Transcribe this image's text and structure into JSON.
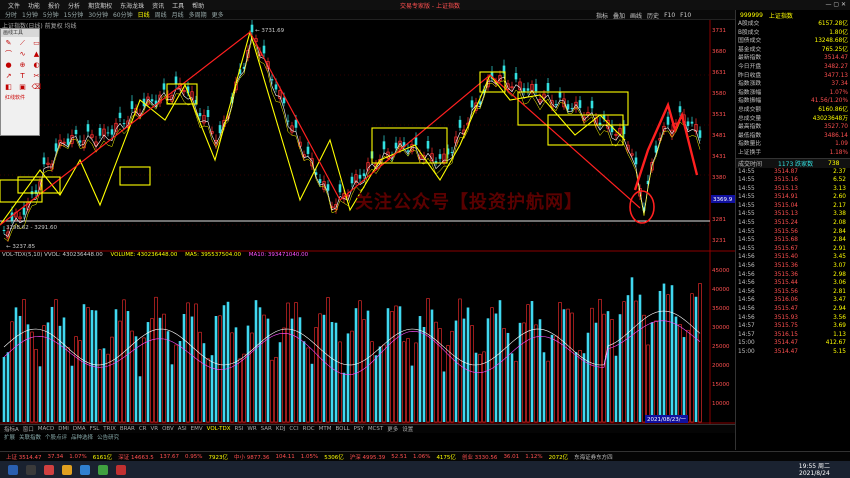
{
  "app_title": "交易专家版 - 上证指数",
  "menus": [
    "文件",
    "功能",
    "报价",
    "分析",
    "期货期权",
    "东海龙珠",
    "资讯",
    "工具",
    "帮助"
  ],
  "periods": [
    "分时",
    "1分钟",
    "5分钟",
    "15分钟",
    "30分钟",
    "60分钟",
    "日线",
    "周线",
    "月线",
    "多周期",
    "更多"
  ],
  "active_period": "日线",
  "right_tools": [
    "指标",
    "叠加",
    "画线",
    "历史",
    "F10",
    "F10"
  ],
  "chart_title": "上证指数(日线) 前复权 均线",
  "drawing_tools": {
    "title": "画线工具",
    "footer": "红线软件",
    "buttons": [
      "✎",
      "⟋",
      "▭",
      "⌒",
      "∿",
      "▲",
      "●",
      "⊕",
      "◐",
      "↗",
      "T",
      "✂",
      "◧",
      "▣",
      "⌫"
    ]
  },
  "price_annotations": {
    "high": "3731.69",
    "mid": "3298.62 - 3291.60",
    "low": "3237.85"
  },
  "y_axis": [
    "3731",
    "3680",
    "3631",
    "3580",
    "3531",
    "3481",
    "3431",
    "3380",
    "3331",
    "3281",
    "3231"
  ],
  "vol_legend": {
    "name": "VOL-TDX(5,10) VVOL: 430236448.00",
    "volume": "VOLUME: 430236448.00",
    "ma5": "MA5: 395537504.00",
    "ma10": "MA10: 393471040.00"
  },
  "vol_axis": [
    "45000",
    "40000",
    "35000",
    "30000",
    "25000",
    "20000",
    "15000",
    "10000"
  ],
  "watermark": "关注公众号【投资护航网】",
  "indicator_tabs": [
    "指标A",
    "窗口",
    "MACD",
    "DMI",
    "DMA",
    "FSL",
    "TRIX",
    "BRAR",
    "CR",
    "VR",
    "OBV",
    "ASI",
    "EMV",
    "VOL-TDX",
    "RSI",
    "WR",
    "SAR",
    "KDJ",
    "CCI",
    "ROC",
    "MTM",
    "BOLL",
    "PSY",
    "MCST",
    "更多",
    "设置"
  ],
  "indicator_tabs2": [
    "扩展",
    "关联指数",
    "个股点评",
    "品种选择",
    "公告研究"
  ],
  "date_box": "2021/08/23/一",
  "side": {
    "code": "999999",
    "name": "上证指数",
    "stats": [
      [
        "A股成交",
        "6157.28亿"
      ],
      [
        "B股成交",
        "1.80亿"
      ],
      [
        "国债成交",
        "13248.68亿"
      ],
      [
        "基金成交",
        "765.25亿"
      ],
      [
        "最新指数",
        "3514.47"
      ],
      [
        "今日开盘",
        "3482.27"
      ],
      [
        "昨日收盘",
        "3477.13"
      ],
      [
        "指数涨跌",
        "37.34"
      ],
      [
        "指数涨幅",
        "1.07%"
      ],
      [
        "指数振幅",
        "41.56/1.20%"
      ],
      [
        "总成交额",
        "6160.86亿"
      ],
      [
        "总成交量",
        "43023648万"
      ],
      [
        "最高指数",
        "3527.70"
      ],
      [
        "最低指数",
        "3486.14"
      ],
      [
        "指数量比",
        "1.09"
      ],
      [
        "上证换手",
        "1.18%"
      ]
    ],
    "ticks_head": [
      "成交时间",
      "1173 跌家数",
      "738"
    ],
    "ticks": [
      [
        "14:55",
        "3514.87",
        "2.37"
      ],
      [
        "14:55",
        "3515.16",
        "6.52"
      ],
      [
        "14:55",
        "3515.13",
        "3.13"
      ],
      [
        "14:55",
        "3514.91",
        "2.60"
      ],
      [
        "14:55",
        "3515.04",
        "2.17"
      ],
      [
        "14:55",
        "3515.13",
        "3.38"
      ],
      [
        "14:55",
        "3515.24",
        "2.08"
      ],
      [
        "14:55",
        "3515.56",
        "2.84"
      ],
      [
        "14:55",
        "3515.68",
        "2.84"
      ],
      [
        "14:55",
        "3515.67",
        "2.91"
      ],
      [
        "14:56",
        "3515.40",
        "3.45"
      ],
      [
        "14:56",
        "3515.36",
        "3.07"
      ],
      [
        "14:56",
        "3515.36",
        "2.98"
      ],
      [
        "14:56",
        "3515.44",
        "3.06"
      ],
      [
        "14:56",
        "3515.56",
        "2.81"
      ],
      [
        "14:56",
        "3516.06",
        "3.47"
      ],
      [
        "14:56",
        "3515.47",
        "2.94"
      ],
      [
        "14:56",
        "3515.93",
        "3.56"
      ],
      [
        "14:57",
        "3515.75",
        "3.69"
      ],
      [
        "14:57",
        "3516.15",
        "1.13"
      ],
      [
        "15:00",
        "3514.47",
        "412.67"
      ],
      [
        "15:00",
        "3514.47",
        "5.15"
      ]
    ]
  },
  "statusbar": [
    {
      "t": "上证 3514.47",
      "c": "#ff5050"
    },
    {
      "t": "37.34",
      "c": "#ff5050"
    },
    {
      "t": "1.07%",
      "c": "#ff5050"
    },
    {
      "t": "6161亿",
      "c": "#ffff00"
    },
    {
      "t": "深证 14663.5",
      "c": "#ff5050"
    },
    {
      "t": "137.67",
      "c": "#ff5050"
    },
    {
      "t": "0.95%",
      "c": "#ff5050"
    },
    {
      "t": "7923亿",
      "c": "#ffff00"
    },
    {
      "t": "中小 9877.36",
      "c": "#ff5050"
    },
    {
      "t": "104.11",
      "c": "#ff5050"
    },
    {
      "t": "1.05%",
      "c": "#ff5050"
    },
    {
      "t": "5306亿",
      "c": "#ffff00"
    },
    {
      "t": "沪深 4995.39",
      "c": "#ff5050"
    },
    {
      "t": "52.51",
      "c": "#ff5050"
    },
    {
      "t": "1.06%",
      "c": "#ff5050"
    },
    {
      "t": "4175亿",
      "c": "#ffff00"
    },
    {
      "t": "创业 3330.56",
      "c": "#ff5050"
    },
    {
      "t": "36.01",
      "c": "#ff5050"
    },
    {
      "t": "1.12%",
      "c": "#ff5050"
    },
    {
      "t": "2072亿",
      "c": "#ffff00"
    },
    {
      "t": "东海证券东方四",
      "c": "#c0c0c0"
    }
  ],
  "clock": {
    "time": "19:55 周二",
    "date": "2021/8/24"
  },
  "colors": {
    "up": "#ff3030",
    "down": "#33e0e0",
    "trend": "#ffff00",
    "highlight": "#ff2020"
  }
}
